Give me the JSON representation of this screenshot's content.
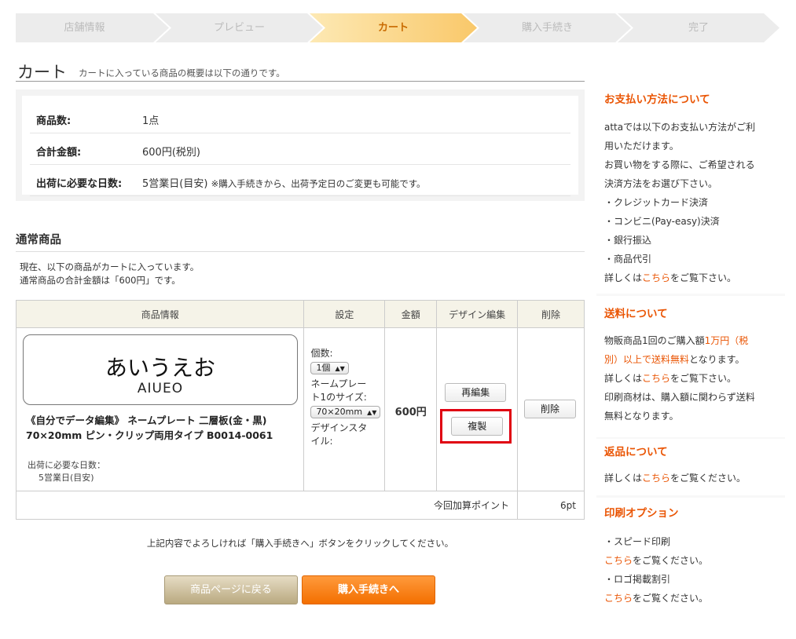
{
  "steps": [
    "店舗情報",
    "プレビュー",
    "カート",
    "購入手続き",
    "完了"
  ],
  "header": {
    "title": "カート",
    "subtitle": "カートに入っている商品の概要は以下の通りです。"
  },
  "summary": {
    "count_label": "商品数:",
    "count_value": "1点",
    "total_label": "合計金額:",
    "total_value": "600円(税別)",
    "days_label": "出荷に必要な日数:",
    "days_value": "5営業日(目安)",
    "days_note": "※購入手続きから、出荷予定日のご変更も可能です。"
  },
  "section": {
    "title": "通常商品",
    "intro_1": "現在、以下の商品がカートに入っています。",
    "intro_2": "通常商品の合計金額は「600円」です。"
  },
  "table": {
    "headers": [
      "商品情報",
      "設定",
      "金額",
      "デザイン編集",
      "削除"
    ],
    "product": {
      "image_text_jp": "あいうえお",
      "image_text_en": "AIUEO",
      "name_1": "《自分でデータ編集》 ネームプレート 二層板(金・黒)",
      "name_2": "70×20mm ピン・クリップ両用タイプ B0014-0061",
      "ship_label": "出荷に必要な日数：",
      "ship_value": "5営業日(目安)"
    },
    "settings": {
      "qty_label": "個数:",
      "qty_value": "1個",
      "size_label_1": "ネームプレー",
      "size_label_2": "ト1のサイズ:",
      "size_value": "70×20mm",
      "style_label_1": "デザインスタ",
      "style_label_2": "イル:"
    },
    "price": "600円",
    "reedit_label": "再編集",
    "copy_label": "複製",
    "delete_label": "削除",
    "points_label": "今回加算ポイント",
    "points_value": "6pt"
  },
  "guide_text": "上記内容でよろしければ「購入手続きへ」ボタンをクリックしてください。",
  "buttons": {
    "back": "商品ページに戻る",
    "proceed": "購入手続きへ"
  },
  "sidebar": {
    "payment": {
      "title": "お支払い方法について",
      "lines": [
        "attaでは以下のお支払い方法がご利",
        "用いただけます。",
        "お買い物をする際に、ご希望される",
        "決済方法をお選び下さい。",
        "・クレジットカード決済",
        "・コンビニ(Pay-easy)決済",
        "・銀行振込",
        "・商品代引"
      ],
      "more_pre": "詳しくは",
      "link": "こちら",
      "more_post": "をご覧下さい。"
    },
    "shipping": {
      "title": "送料について",
      "l1_pre": "物販商品1回のご購入額",
      "l1_hl": "1万円（税",
      "l2_hl": "別）以上で送料無料",
      "l2_post": "となります。",
      "more_pre": "詳しくは",
      "link": "こちら",
      "more_post": "をご覧下さい。",
      "l4": "印刷商材は、購入額に関わらず送料",
      "l5": "無料となります。"
    },
    "returns": {
      "title": "返品について",
      "more_pre": "詳しくは",
      "link": "こちら",
      "more_post": "をご覧ください。"
    },
    "print": {
      "title": "印刷オプション",
      "opt1": "・スピード印刷",
      "link": "こちら",
      "post": "をご覧ください。",
      "opt2": "・ロゴ掲載割引"
    }
  },
  "colors": {
    "accent": "#ea5504",
    "highlight_box": "#e00012",
    "step_active": "#f9c86a"
  }
}
